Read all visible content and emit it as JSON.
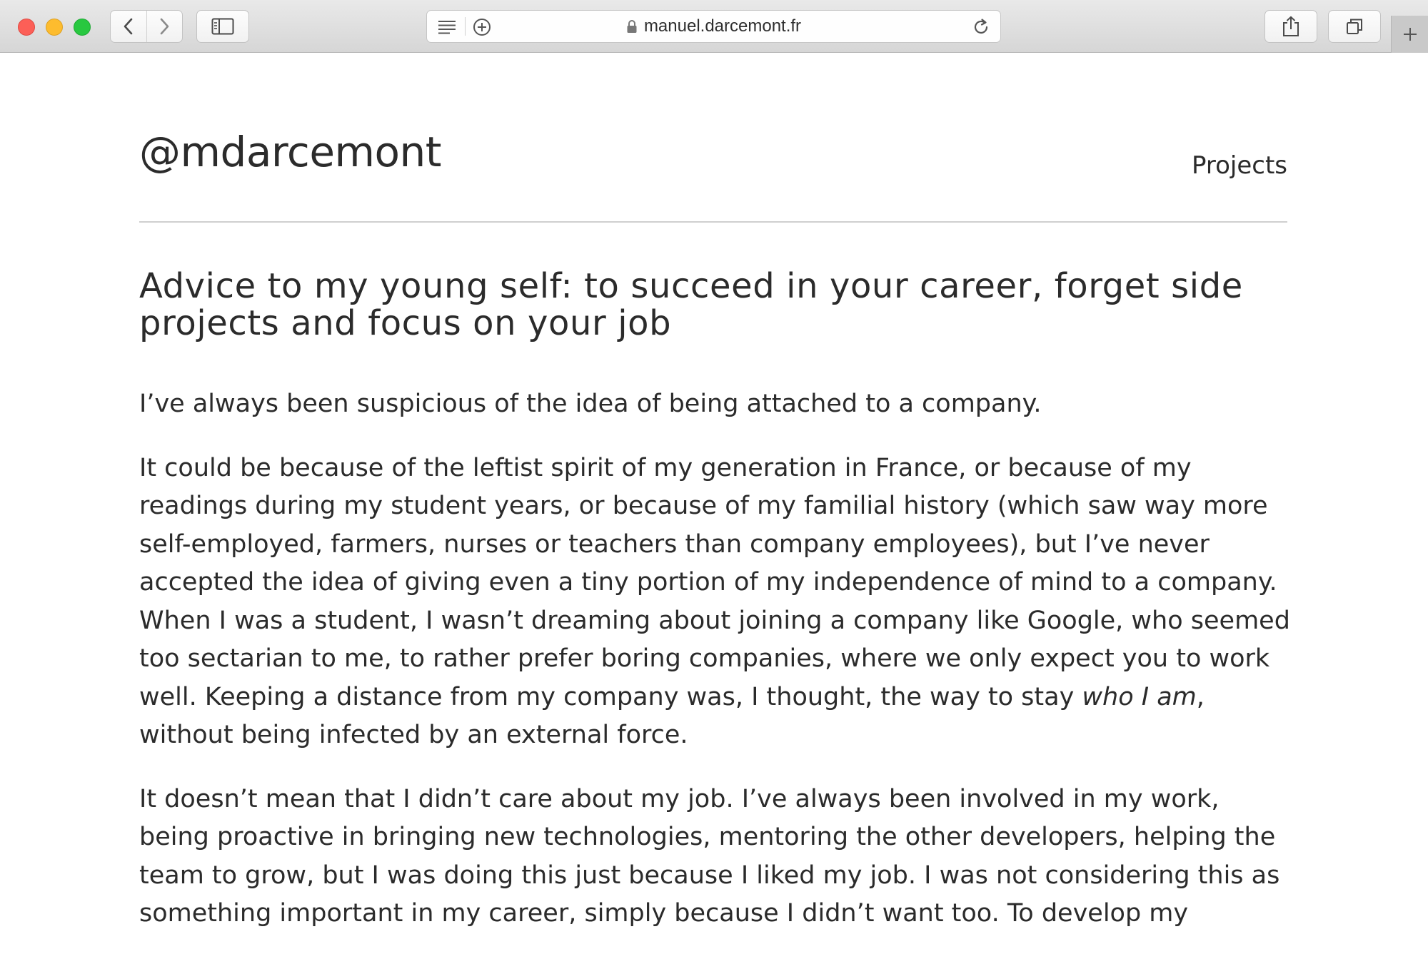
{
  "browser": {
    "url": "manuel.darcemont.fr",
    "icons": {
      "back": "chevron-left-icon",
      "forward": "chevron-right-icon",
      "sidebar": "sidebar-icon",
      "reader": "reader-icon",
      "add": "add-circle-icon",
      "lock": "lock-icon",
      "reload": "reload-icon",
      "share": "share-icon",
      "tabs": "tabs-overview-icon",
      "new_tab": "plus-icon"
    },
    "colors": {
      "close": "#fc5f57",
      "minimize": "#fdbc2e",
      "zoom": "#28c840"
    }
  },
  "site": {
    "title": "@mdarcemont",
    "nav": {
      "projects": "Projects"
    }
  },
  "article": {
    "title": "Advice to my young self: to succeed in your career, forget side projects and focus on your job",
    "paragraphs": {
      "p1": "I’ve always been suspicious of the idea of being attached to a company.",
      "p2_before": "It could be because of the leftist spirit of my generation in France, or because of my readings during my student years, or because of my familial history (which saw way more self-employed, farmers, nurses or teachers than company employees), but I’ve never accepted the idea of giving even a tiny portion of my independence of mind to a company. When I was a student, I wasn’t dreaming about joining a company like Google, who seemed too sectarian to me, to rather prefer boring companies, where we only expect you to work well. Keeping a distance from my company was, I thought, the way to stay ",
      "p2_emphasis": "who I am",
      "p2_after": ", without being infected by an external force.",
      "p3": "It doesn’t mean that I didn’t care about my job. I’ve always been involved in my work, being proactive in bringing new technologies, mentoring the other developers, helping the team to grow, but I was doing this just because I liked my job. I was not considering this as something important in my career, simply because I didn’t want too. To develop my"
    }
  }
}
